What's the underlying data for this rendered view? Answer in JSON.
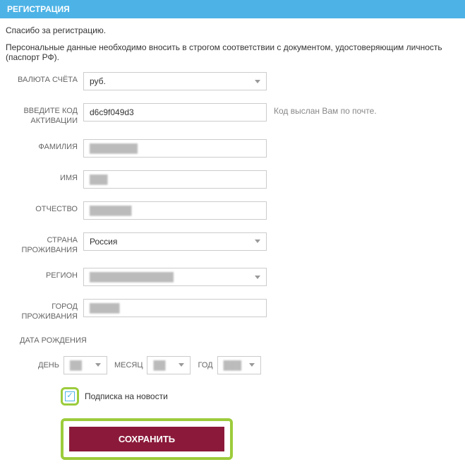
{
  "header": {
    "title": "РЕГИСТРАЦИЯ"
  },
  "thanks": "Спасибо за регистрацию.",
  "note": "Персональные данные необходимо вносить в строгом соответствии с документом, удостоверяющим личность (паспорт РФ).",
  "currency": {
    "label": "ВАЛЮТА СЧЁТА",
    "value": "руб."
  },
  "activation": {
    "label": "ВВЕДИТЕ КОД АКТИВАЦИИ",
    "value": "d6c9f049d3",
    "hint": "Код выслан Вам по почте."
  },
  "lastname": {
    "label": "ФАМИЛИЯ",
    "value": ""
  },
  "firstname": {
    "label": "ИМЯ",
    "value": ""
  },
  "patronymic": {
    "label": "ОТЧЕСТВО",
    "value": ""
  },
  "country": {
    "label": "СТРАНА ПРОЖИВАНИЯ",
    "value": "Россия"
  },
  "region": {
    "label": "РЕГИОН",
    "value": ""
  },
  "city": {
    "label": "ГОРОД ПРОЖИВАНИЯ",
    "value": ""
  },
  "dob": {
    "title": "ДАТА РОЖДЕНИЯ",
    "day_label": "ДЕНЬ",
    "month_label": "МЕСЯЦ",
    "year_label": "ГОД",
    "day": "",
    "month": "",
    "year": ""
  },
  "subscribe": {
    "label": "Подписка на новости",
    "checked": true
  },
  "save": {
    "label": "СОХРАНИТЬ"
  }
}
